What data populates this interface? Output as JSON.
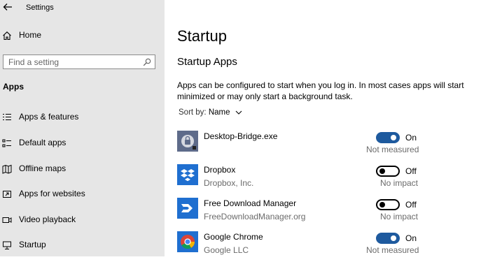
{
  "window": {
    "title": "Settings"
  },
  "sidebar": {
    "home_label": "Home",
    "search_placeholder": "Find a setting",
    "section": "Apps",
    "items": [
      {
        "label": "Apps & features",
        "icon": "list-icon"
      },
      {
        "label": "Default apps",
        "icon": "default-apps-icon"
      },
      {
        "label": "Offline maps",
        "icon": "map-icon"
      },
      {
        "label": "Apps for websites",
        "icon": "external-link-icon"
      },
      {
        "label": "Video playback",
        "icon": "video-icon"
      },
      {
        "label": "Startup",
        "icon": "startup-icon"
      }
    ]
  },
  "main": {
    "title": "Startup",
    "subtitle": "Startup Apps",
    "description": "Apps can be configured to start when you log in. In most cases apps will start minimized or may only start a background task.",
    "sort_prefix": "Sort by:",
    "sort_value": "Name",
    "apps": [
      {
        "name": "Desktop-Bridge.exe",
        "publisher": "",
        "state": "On",
        "enabled": true,
        "impact": "Not measured",
        "icon": "desktop-bridge-icon",
        "color": "#5e6b8a"
      },
      {
        "name": "Dropbox",
        "publisher": "Dropbox, Inc.",
        "state": "Off",
        "enabled": false,
        "impact": "No impact",
        "icon": "dropbox-icon",
        "color": "#1f6fd0"
      },
      {
        "name": "Free Download Manager",
        "publisher": "FreeDownloadManager.org",
        "state": "Off",
        "enabled": false,
        "impact": "No impact",
        "icon": "fdm-icon",
        "color": "#1f6fd0"
      },
      {
        "name": "Google Chrome",
        "publisher": "Google LLC",
        "state": "On",
        "enabled": true,
        "impact": "Not measured",
        "icon": "chrome-icon",
        "color": "#1f6fd0"
      }
    ]
  },
  "colors": {
    "accent": "#1e5a9e",
    "sidebar_bg": "#e6e6e6",
    "tile_blue": "#1f6fd0"
  }
}
